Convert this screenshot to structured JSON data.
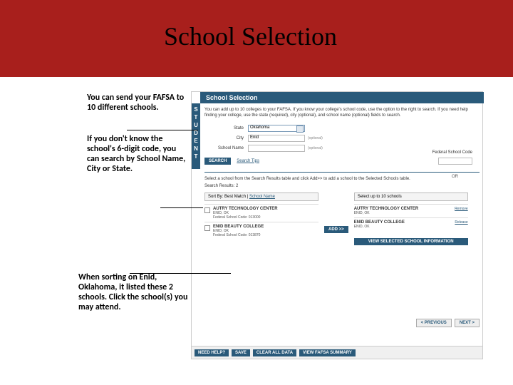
{
  "slide": {
    "title": "School Selection"
  },
  "annotations": {
    "a1": "You can send your FAFSA to 10 different schools.",
    "a2": "If you don't know the school's 6-digit code, you can search by School Name, City or State.",
    "a3": "When sorting on Enid, Oklahoma, it listed these 2 schools.  Click the school(s) you may attend."
  },
  "screenshot": {
    "header": "School Selection",
    "student_tab": "STUDENT",
    "intro": "You can add up to 10 colleges to your FAFSA. If you know your college's school code, use the option to the right to search. If you need help finding your college, use the state (required), city (optional), and school name (optional) fields to search.",
    "labels": {
      "state": "State",
      "city": "City",
      "school_name": "School Name",
      "fed_code": "Federal School Code",
      "optional": "(optional)",
      "or": "OR"
    },
    "values": {
      "state": "Oklahoma",
      "city": "Enid"
    },
    "buttons": {
      "search": "SEARCH",
      "add": "ADD >>",
      "previous": "< PREVIOUS",
      "next": "NEXT >",
      "view_selected": "VIEW SELECTED SCHOOL INFORMATION",
      "need_help": "NEED HELP?",
      "save": "SAVE",
      "clear": "CLEAR ALL DATA",
      "view_summary": "VIEW FAFSA SUMMARY"
    },
    "links": {
      "search_tips": "Search Tips",
      "school_name_sort": "School Name",
      "remove": "Remove",
      "release": "Release"
    },
    "subintro": "Select a school from the Search Results table and click Add>> to add a school to the Selected Schools table.",
    "results_label": "Search Results:",
    "results_count": "2",
    "sort_label": "Sort By:",
    "sort_active": "Best Match",
    "sort_divider": " | ",
    "selected_header": "Select up to 10 schools",
    "results": [
      {
        "name": "AUTRY TECHNOLOGY CENTER",
        "loc": "ENID, OK",
        "code": "Federal School Code: 013000"
      },
      {
        "name": "ENID BEAUTY COLLEGE",
        "loc": "ENID, OK",
        "code": "Federal School Code: 013870"
      }
    ],
    "selected": [
      {
        "name": "AUTRY TECHNOLOGY CENTER",
        "loc": "ENID, OK"
      },
      {
        "name": "ENID BEAUTY COLLEGE",
        "loc": "ENID, OK"
      }
    ]
  }
}
